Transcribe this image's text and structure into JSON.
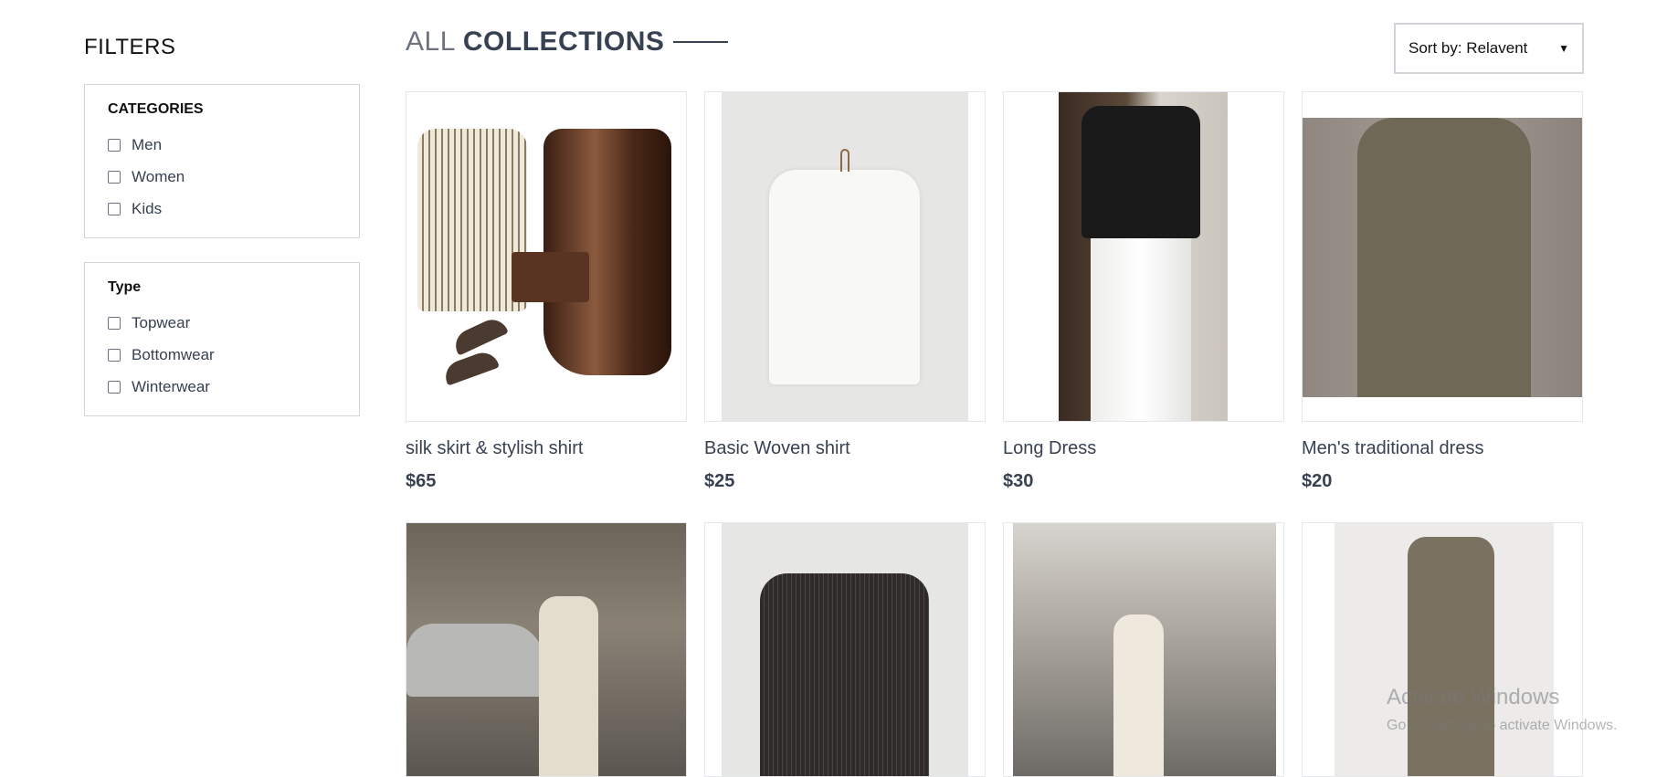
{
  "sidebar": {
    "title": "FILTERS",
    "categories": {
      "title": "CATEGORIES",
      "options": [
        "Men",
        "Women",
        "Kids"
      ]
    },
    "type": {
      "title": "Type",
      "options": [
        "Topwear",
        "Bottomwear",
        "Winterwear"
      ]
    }
  },
  "header": {
    "title_light": "ALL",
    "title_dark": "COLLECTIONS",
    "sort_label": "Sort by: Relavent"
  },
  "products": [
    {
      "name": "silk skirt & stylish shirt",
      "price": "$65"
    },
    {
      "name": "Basic Woven shirt",
      "price": "$25"
    },
    {
      "name": "Long Dress",
      "price": "$30"
    },
    {
      "name": "Men's traditional dress",
      "price": "$20"
    }
  ],
  "watermark": {
    "line1": "Activate Windows",
    "line2": "Go to Settings to activate Windows."
  },
  "colors": {
    "accent": "#374151",
    "border": "#d1d5db"
  }
}
